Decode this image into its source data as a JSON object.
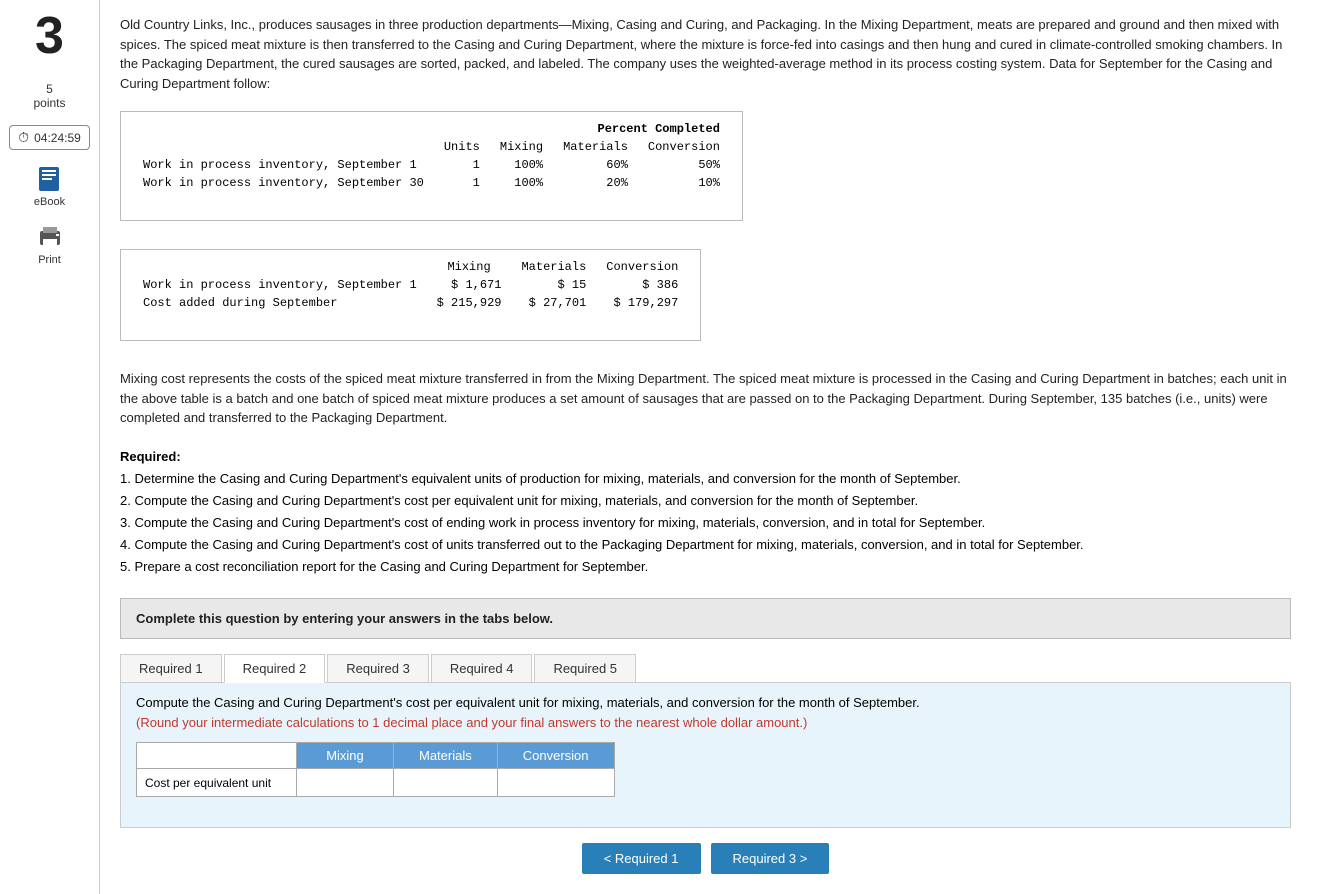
{
  "sidebar": {
    "question_number": "3",
    "points_value": "5",
    "points_label": "points",
    "timer": "04:24:59",
    "ebook_label": "eBook",
    "print_label": "Print"
  },
  "problem": {
    "text": "Old Country Links, Inc., produces sausages in three production departments—Mixing, Casing and Curing, and Packaging. In the Mixing Department, meats are prepared and ground and then mixed with spices. The spiced meat mixture is then transferred to the Casing and Curing Department, where the mixture is force-fed into casings and then hung and cured in climate-controlled smoking chambers. In the Packaging Department, the cured sausages are sorted, packed, and labeled. The company uses the weighted-average method in its process costing system. Data for September for the Casing and Curing Department follow:"
  },
  "table1": {
    "header_percent_completed": "Percent Completed",
    "col_units": "Units",
    "col_mixing": "Mixing",
    "col_materials": "Materials",
    "col_conversion": "Conversion",
    "rows": [
      {
        "label": "Work in process inventory, September 1",
        "units": "1",
        "mixing": "100%",
        "materials": "60%",
        "conversion": "50%"
      },
      {
        "label": "Work in process inventory, September 30",
        "units": "1",
        "mixing": "100%",
        "materials": "20%",
        "conversion": "10%"
      }
    ]
  },
  "table2": {
    "col_mixing": "Mixing",
    "col_materials": "Materials",
    "col_conversion": "Conversion",
    "rows": [
      {
        "label": "Work in process inventory, September 1",
        "mixing": "$ 1,671",
        "materials": "$     15",
        "conversion": "$     386"
      },
      {
        "label": "Cost added during September",
        "mixing": "$ 215,929",
        "materials": "$ 27,701",
        "conversion": "$ 179,297"
      }
    ]
  },
  "mixing_cost_text": "Mixing cost represents the costs of the spiced meat mixture transferred in from the Mixing Department. The spiced meat mixture is processed in the Casing and Curing Department in batches; each unit in the above table is a batch and one batch of spiced meat mixture produces a set amount of sausages that are passed on to the Packaging Department. During September, 135 batches (i.e., units) were completed and transferred to the Packaging Department.",
  "required": {
    "title": "Required:",
    "items": [
      "1. Determine the Casing and Curing Department's equivalent units of production for mixing, materials, and conversion for the month of September.",
      "2. Compute the Casing and Curing Department's cost per equivalent unit for mixing, materials, and conversion for the month of September.",
      "3. Compute the Casing and Curing Department's cost of ending work in process inventory for mixing, materials, conversion, and in total for September.",
      "4. Compute the Casing and Curing Department's cost of units transferred out to the Packaging Department for mixing, materials, conversion, and in total for September.",
      "5. Prepare a cost reconciliation report for the Casing and Curing Department for September."
    ]
  },
  "complete_box": {
    "text": "Complete this question by entering your answers in the tabs below."
  },
  "tabs": [
    {
      "label": "Required 1",
      "id": "req1",
      "active": false
    },
    {
      "label": "Required 2",
      "id": "req2",
      "active": true
    },
    {
      "label": "Required 3",
      "id": "req3",
      "active": false
    },
    {
      "label": "Required 4",
      "id": "req4",
      "active": false
    },
    {
      "label": "Required 5",
      "id": "req5",
      "active": false
    }
  ],
  "tab_content": {
    "main_text": "Compute the Casing and Curing Department's cost per equivalent unit for mixing, materials, and conversion for the month of September.",
    "note_text": "(Round your intermediate calculations to 1 decimal place and your final answers to the nearest whole dollar amount.)",
    "table": {
      "row_label": "Cost per equivalent unit",
      "col_mixing": "Mixing",
      "col_materials": "Materials",
      "col_conversion": "Conversion"
    }
  },
  "nav_buttons": {
    "prev_label": "< Required 1",
    "next_label": "Required 3 >"
  }
}
